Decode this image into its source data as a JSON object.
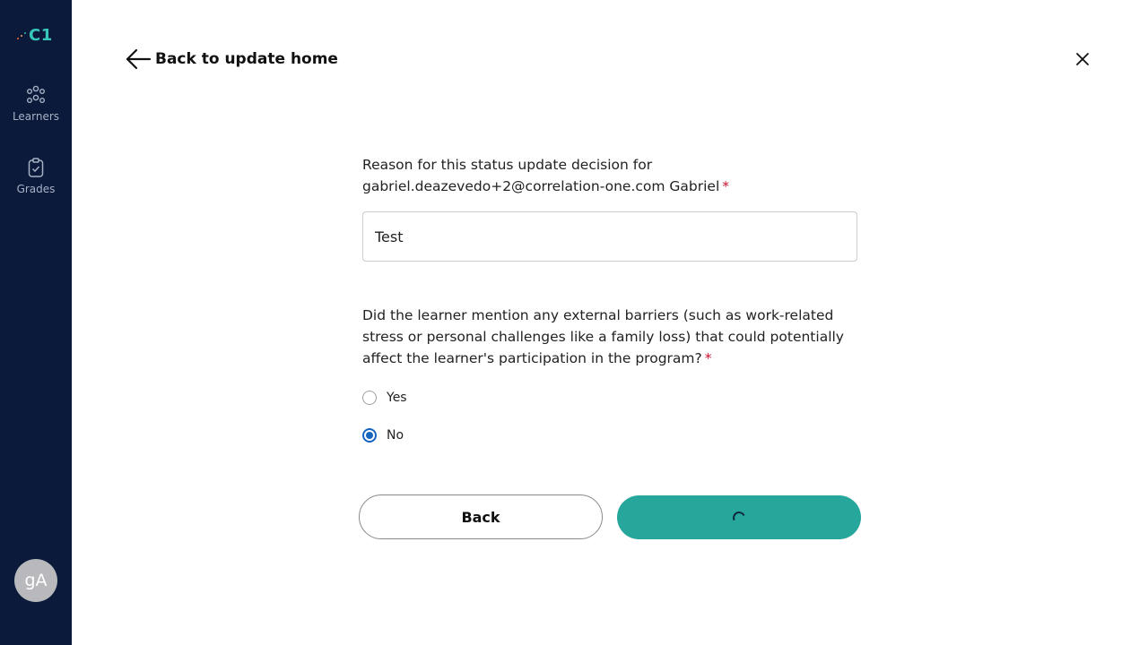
{
  "app": {
    "logo_text": "C1",
    "brand_color": "#38c6b8",
    "sidebar_color": "#0b1a3b"
  },
  "sidebar": {
    "items": [
      {
        "label": "Learners",
        "icon": "learners-icon"
      },
      {
        "label": "Grades",
        "icon": "clipboard-check-icon"
      }
    ],
    "avatar_initials": "gA"
  },
  "header": {
    "back_label": "Back to update home",
    "close_icon": "close-icon"
  },
  "form": {
    "reason_label_line1": "Reason for this status update decision for",
    "reason_label_line2": "gabriel.deazevedo+2@correlation-one.com Gabriel",
    "required_mark": "*",
    "reason_value": "Test",
    "barriers_question": "Did the learner mention any external barriers (such as work-related stress or personal challenges like a family loss) that could potentially affect the learner's participation in the program?",
    "options": [
      {
        "label": "Yes",
        "checked": false
      },
      {
        "label": "No",
        "checked": true
      }
    ],
    "back_button_label": "Back",
    "submit_state": "loading",
    "submit_color": "#27a69c"
  }
}
